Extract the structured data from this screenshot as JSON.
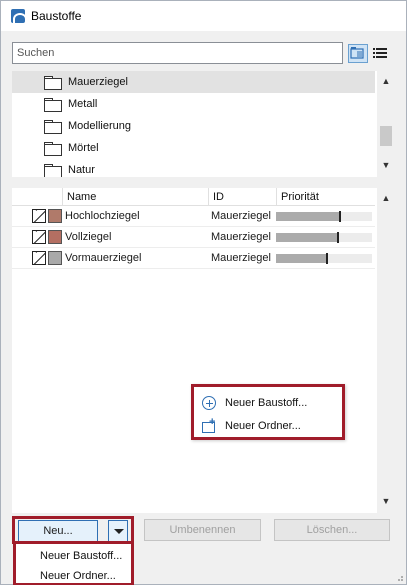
{
  "window": {
    "title": "Baustoffe",
    "app_icon": "archicad-icon"
  },
  "search": {
    "placeholder": "Suchen",
    "value": ""
  },
  "view_buttons": [
    {
      "icon": "folder-view-icon",
      "active": true
    },
    {
      "icon": "list-view-icon",
      "active": false
    }
  ],
  "folders": [
    {
      "label": "Mauerziegel",
      "selected": true
    },
    {
      "label": "Metall",
      "selected": false
    },
    {
      "label": "Modellierung",
      "selected": false
    },
    {
      "label": "Mörtel",
      "selected": false
    },
    {
      "label": "Natur",
      "selected": false
    }
  ],
  "table": {
    "headers": {
      "name": "Name",
      "id": "ID",
      "priority": "Priorität"
    },
    "rows": [
      {
        "name": "Hochlochziegel",
        "id": "Mauerziegel",
        "swatch": "#b07a6a",
        "priority": 0.66
      },
      {
        "name": "Vollziegel",
        "id": "Mauerziegel",
        "swatch": "#b46f62",
        "priority": 0.64
      },
      {
        "name": "Vormauerziegel",
        "id": "Mauerziegel",
        "swatch": "#a9a9a9",
        "priority": 0.52
      }
    ]
  },
  "context_menu": {
    "items": [
      {
        "label": "Neuer Baustoff...",
        "icon": "add-circle-icon"
      },
      {
        "label": "Neuer Ordner...",
        "icon": "new-folder-icon"
      }
    ]
  },
  "buttons": {
    "new": "Neu...",
    "rename": "Umbenennen",
    "delete": "Löschen..."
  },
  "new_dropdown": {
    "items": [
      "Neuer Baustoff...",
      "Neuer Ordner..."
    ]
  },
  "colors": {
    "highlight_border": "#a01c2a",
    "accent": "#2f6fb3"
  }
}
